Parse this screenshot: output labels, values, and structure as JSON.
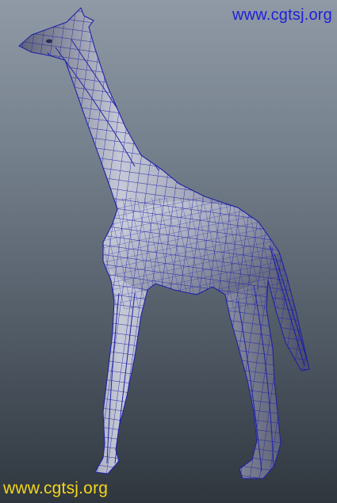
{
  "watermarks": {
    "top": "www.cgtsj.org",
    "bottom": "www.cgtsj.org"
  },
  "colors": {
    "wire": "#1e22a6",
    "mesh_light": "#d8dbe4",
    "mesh_mid": "#9ea2b4",
    "mesh_dark": "#4e5266",
    "top_watermark": "#1f1fd8",
    "bottom_watermark": "#f4d61a"
  },
  "viewport": {
    "subject": "giraffe-wireframe-model"
  }
}
